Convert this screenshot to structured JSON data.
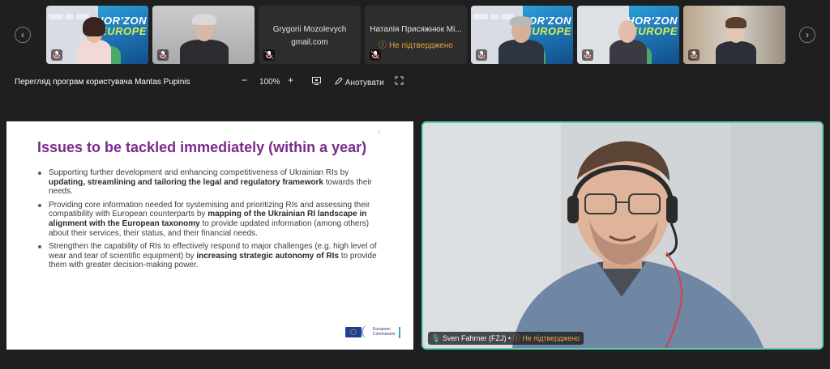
{
  "participants": [
    {
      "name": "",
      "kind": "video-poster"
    },
    {
      "name": "",
      "kind": "video"
    },
    {
      "name": "Grygorii Mozolevych",
      "subtitle": "gmail.com",
      "kind": "name"
    },
    {
      "name": "Наталія Присяжнюк  Мі...",
      "subtitle": "Не підтверджено",
      "kind": "name"
    },
    {
      "name": "",
      "kind": "video-poster"
    },
    {
      "name": "",
      "kind": "video"
    },
    {
      "name": "",
      "kind": "video"
    }
  ],
  "poster": {
    "line1": "HOR'ZON",
    "line2": "EUROPE"
  },
  "toolbar": {
    "title": "Перегляд програм користувача Mantas Pupinis",
    "zoom_out": "−",
    "zoom": "100%",
    "zoom_in": "+",
    "annotate": "Анотувати"
  },
  "slide": {
    "title": "Issues to be tackled immediately (within a year)",
    "mark": "L",
    "bullets": [
      {
        "pre": "Supporting further development and enhancing competitiveness of Ukrainian RIs by ",
        "bold": "updating, streamlining and tailoring the legal and regulatory framework",
        "post": " towards their needs."
      },
      {
        "pre": "Providing core information needed for systemising and prioritizing RIs and assessing their compatibility with European counterparts by ",
        "bold": "mapping of the Ukrainian RI landscape in alignment with the European taxonomy",
        "post": " to provide updated information (among others) about their services, their status, and their financial needs."
      },
      {
        "pre": "Strengthen the capability of RIs to effectively respond to major challenges (e.g. high level of wear and tear of scientific equipment) by ",
        "bold": "increasing strategic autonomy of RIs",
        "post": " to provide them with greater decision-making power."
      }
    ],
    "logo_line1": "European",
    "logo_line2": "Commission"
  },
  "speaker": {
    "name": "Sven Fahrner (FZJ)",
    "separator": "•",
    "status": "Не підтверджено"
  },
  "colors": {
    "title_purple": "#7a2a8c",
    "active_border": "#5fd0b8",
    "pending_orange": "#e8a33d"
  }
}
